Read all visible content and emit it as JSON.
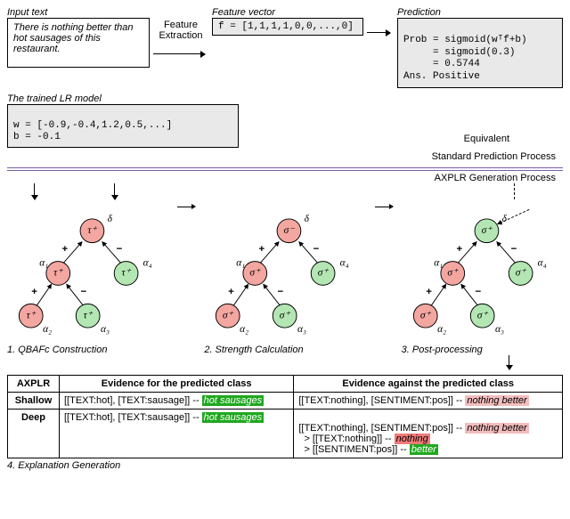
{
  "top": {
    "input_label": "Input text",
    "input_text": "There is nothing better than hot sausages of this restaurant.",
    "feat_extraction_label": "Feature Extraction",
    "feat_vector_label": "Feature vector",
    "feat_vector_value": "f = [1,1,1,1,0,0,...,0]",
    "prediction_label": "Prediction",
    "prediction_lines": {
      "l1": "Prob = sigmoid(wᵀf+b)",
      "l2": "     = sigmoid(0.3)",
      "l3": "     = 0.5744",
      "l4": "Ans. Positive"
    },
    "model_label": "The trained LR model",
    "model_w": "w = [-0.9,-0.4,1.2,0.5,...]",
    "model_b": "b = -0.1",
    "equivalent_label": "Equivalent",
    "proc_top": "Standard Prediction Process",
    "proc_bottom": "AXPLR Generation Process"
  },
  "steps": {
    "s1_caption": "1. QBAFc Construction",
    "s2_caption": "2. Strength Calculation",
    "s3_caption": "3. Post-processing",
    "s4_caption": "4. Explanation Generation",
    "delta": "δ",
    "alpha1": "α₁",
    "alpha2": "α₂",
    "alpha3": "α₃",
    "alpha4": "α₄",
    "tau_plus": "τ⁺",
    "sigma_plus": "σ⁺",
    "sigma_minus": "σ⁻"
  },
  "table": {
    "h0": "AXPLR",
    "h1": "Evidence for the predicted class",
    "h2": "Evidence against the predicted class",
    "r_shallow": "Shallow",
    "r_deep": "Deep",
    "for_shallow_pre": "[[TEXT:hot], [TEXT:sausage]] -- ",
    "for_shallow_hl": "hot sausages",
    "against_shallow_pre": "[[TEXT:nothing], [SENTIMENT:pos]] -- ",
    "against_shallow_hl": "nothing better",
    "for_deep_pre": "[[TEXT:hot], [TEXT:sausage]] -- ",
    "for_deep_hl": "hot sausages",
    "against_deep_l1_pre": "[[TEXT:nothing], [SENTIMENT:pos]] -- ",
    "against_deep_l1_hl": "nothing better",
    "against_deep_l2_pre": "  > [[TEXT:nothing]] -- ",
    "against_deep_l2_hl": "nothing",
    "against_deep_l3_pre": "  > [[SENTIMENT:pos]] -- ",
    "against_deep_l3_hl": "better"
  }
}
